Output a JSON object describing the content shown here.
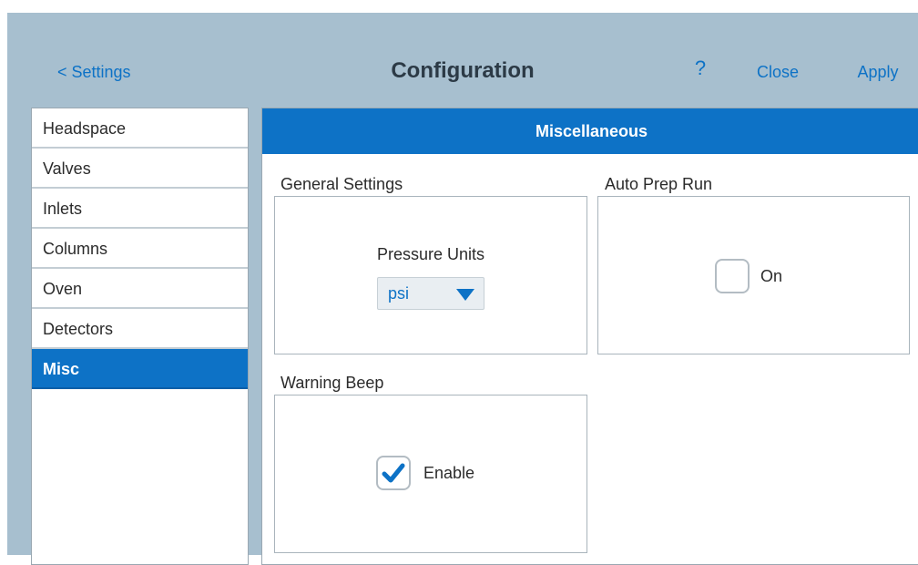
{
  "header": {
    "back_label": "< Settings",
    "title": "Configuration",
    "help_label": "?",
    "close_label": "Close",
    "apply_label": "Apply"
  },
  "sidebar": {
    "items": [
      {
        "label": "Headspace",
        "active": false
      },
      {
        "label": "Valves",
        "active": false
      },
      {
        "label": "Inlets",
        "active": false
      },
      {
        "label": "Columns",
        "active": false
      },
      {
        "label": "Oven",
        "active": false
      },
      {
        "label": "Detectors",
        "active": false
      },
      {
        "label": "Misc",
        "active": true
      }
    ]
  },
  "main": {
    "header": "Miscellaneous",
    "general_settings": {
      "title": "General Settings",
      "pressure_units_label": "Pressure Units",
      "pressure_units_value": "psi"
    },
    "auto_prep_run": {
      "title": "Auto Prep Run",
      "checkbox_label": "On",
      "checked": false
    },
    "warning_beep": {
      "title": "Warning Beep",
      "checkbox_label": "Enable",
      "checked": true
    }
  },
  "colors": {
    "accent": "#0d72c6",
    "background": "#a7bfcf",
    "panel": "#ffffff"
  }
}
